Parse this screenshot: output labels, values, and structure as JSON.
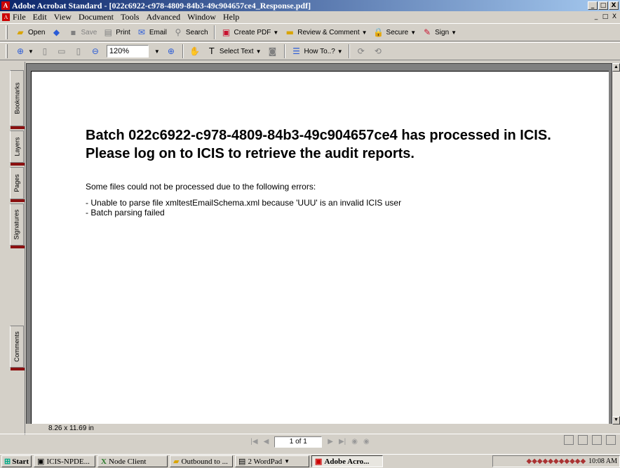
{
  "window": {
    "title": "Adobe Acrobat Standard - [022c6922-c978-4809-84b3-49c904657ce4_Response.pdf]",
    "controls": [
      "_",
      "□",
      "X"
    ]
  },
  "menu": [
    "File",
    "Edit",
    "View",
    "Document",
    "Tools",
    "Advanced",
    "Window",
    "Help"
  ],
  "toolbar1": {
    "open": "Open",
    "save": "Save",
    "print": "Print",
    "email": "Email",
    "search": "Search",
    "create_pdf": "Create PDF",
    "review": "Review & Comment",
    "secure": "Secure",
    "sign": "Sign"
  },
  "toolbar2": {
    "zoom": "120%",
    "select_text": "Select Text",
    "how_to": "How To..?"
  },
  "nav_tabs": [
    "Bookmarks",
    "Layers",
    "Pages",
    "Signatures",
    "Comments"
  ],
  "document": {
    "heading": "Batch 022c6922-c978-4809-84b3-49c904657ce4 has processed in ICIS. Please log on to ICIS to retrieve the audit reports.",
    "intro": "Some files could not be processed due to the following errors:",
    "errors": [
      "- Unable to parse file xmltestEmailSchema.xml because 'UUU' is an invalid ICIS user",
      "- Batch parsing failed"
    ]
  },
  "status": {
    "page_size": "8.26 x 11.69 in",
    "page_indicator": "1 of 1"
  },
  "taskbar": {
    "start": "Start",
    "tasks": [
      "ICIS-NPDE...",
      "Node Client",
      "Outbound to ...",
      "2 WordPad",
      "Adobe Acro..."
    ],
    "clock": "10:08 AM"
  }
}
